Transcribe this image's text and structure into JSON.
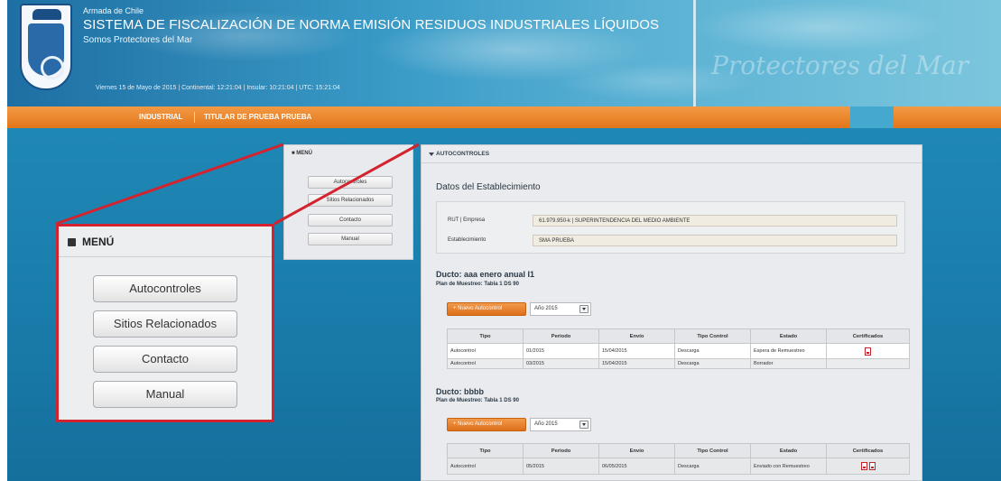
{
  "header": {
    "org": "Armada de Chile",
    "title": "SISTEMA DE FISCALIZACIÓN DE NORMA EMISIÓN RESIDUOS INDUSTRIALES LÍQUIDOS",
    "subtitle": "Somos Protectores del Mar",
    "datetime": "Viernes 15 de Mayo de 2015 | Continental: 12:21:04 | Insular: 10:21:04 | UTC: 15:21:04",
    "script_text": "Protectores del Mar"
  },
  "nav": {
    "items": [
      "INDUSTRIAL",
      "TITULAR DE PRUEBA PRUEBA"
    ]
  },
  "menu_small": {
    "title": "MENÚ",
    "buttons": [
      "Autocontroles",
      "Sitios Relacionados",
      "Contacto",
      "Manual"
    ]
  },
  "menu_big": {
    "title": "MENÚ",
    "buttons": [
      "Autocontroles",
      "Sitios Relacionados",
      "Contacto",
      "Manual"
    ]
  },
  "main": {
    "panel_title": "AUTOCONTROLES",
    "section_title": "Datos del Establecimiento",
    "rut_label": "RUT | Empresa",
    "rut_value": "61.979.950-k | SUPERINTENDENCIA DEL MEDIO AMBIENTE",
    "estab_label": "Establecimiento",
    "estab_value": "SMA PRUEBA",
    "new_button_label": "Nuevo Autocontrol",
    "table_headers": [
      "Tipo",
      "Periodo",
      "Envío",
      "Tipo Control",
      "Estado",
      "Certificados"
    ],
    "ductos": [
      {
        "name": "Ducto: aaa enero anual I1",
        "plan": "Plan de Muestreo: Tabla 1 DS 90",
        "year": "Año 2015",
        "rows": [
          {
            "tipo": "Autocontrol",
            "periodo": "01/2015",
            "envio": "15/04/2015",
            "control": "Descarga",
            "estado": "Espera de Remuestreo",
            "certs": 1
          },
          {
            "tipo": "Autocontrol",
            "periodo": "03/2015",
            "envio": "15/04/2015",
            "control": "Descarga",
            "estado": "Borrador",
            "certs": 0
          }
        ]
      },
      {
        "name": "Ducto: bbbb",
        "plan": "Plan de Muestreo: Tabla 1 DS 90",
        "year": "Año 2015",
        "rows": [
          {
            "tipo": "Autocontrol",
            "periodo": "05/2015",
            "envio": "06/05/2015",
            "control": "Descarga",
            "estado": "Enviado con Remuestreo",
            "certs": 2
          }
        ]
      }
    ]
  },
  "colors": {
    "accent_orange": "#e57a1e",
    "highlight_red": "#d2232e",
    "header_blue": "#2f8fc0"
  },
  "icons": {
    "menu": "square-icon",
    "collapse": "triangle-down-icon",
    "certificate": "pdf-icon",
    "select": "chevron-down-icon"
  }
}
